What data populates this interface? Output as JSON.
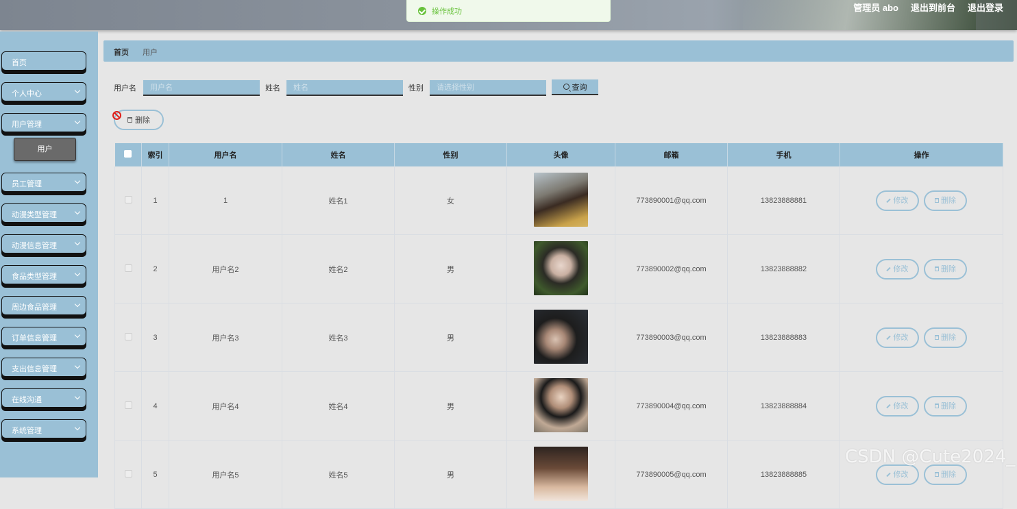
{
  "header": {
    "admin_label": "管理员 abo",
    "exit_front_label": "退出到前台",
    "logout_label": "退出登录"
  },
  "toast": {
    "message": "操作成功",
    "icon": "check-circle-icon",
    "color": "#67c23a"
  },
  "sidebar": {
    "items": [
      {
        "label": "首页",
        "expandable": false
      },
      {
        "label": "个人中心",
        "expandable": true
      },
      {
        "label": "用户管理",
        "expandable": true
      },
      {
        "label": "员工管理",
        "expandable": true
      },
      {
        "label": "动漫类型管理",
        "expandable": true
      },
      {
        "label": "动漫信息管理",
        "expandable": true
      },
      {
        "label": "食品类型管理",
        "expandable": true
      },
      {
        "label": "周边食品管理",
        "expandable": true
      },
      {
        "label": "订单信息管理",
        "expandable": true
      },
      {
        "label": "支出信息管理",
        "expandable": true
      },
      {
        "label": "在线沟通",
        "expandable": true
      },
      {
        "label": "系统管理",
        "expandable": true
      }
    ],
    "active_sub_item": "用户"
  },
  "breadcrumb": {
    "home": "首页",
    "current": "用户"
  },
  "search": {
    "username_label": "用户名",
    "username_placeholder": "用户名",
    "name_label": "姓名",
    "name_placeholder": "姓名",
    "gender_label": "性别",
    "gender_placeholder": "请选择性别",
    "query_label": "查询"
  },
  "toolbar": {
    "delete_label": "删除"
  },
  "table": {
    "headers": [
      "索引",
      "用户名",
      "姓名",
      "性别",
      "头像",
      "邮箱",
      "手机",
      "操作"
    ],
    "edit_label": "修改",
    "delete_label": "删除",
    "rows": [
      {
        "index": "1",
        "username": "1",
        "name": "姓名1",
        "gender": "女",
        "email": "773890001@qq.com",
        "phone": "13823888881"
      },
      {
        "index": "2",
        "username": "用户名2",
        "name": "姓名2",
        "gender": "男",
        "email": "773890002@qq.com",
        "phone": "13823888882"
      },
      {
        "index": "3",
        "username": "用户名3",
        "name": "姓名3",
        "gender": "男",
        "email": "773890003@qq.com",
        "phone": "13823888883"
      },
      {
        "index": "4",
        "username": "用户名4",
        "name": "姓名4",
        "gender": "男",
        "email": "773890004@qq.com",
        "phone": "13823888884"
      },
      {
        "index": "5",
        "username": "用户名5",
        "name": "姓名5",
        "gender": "男",
        "email": "773890005@qq.com",
        "phone": "13823888885"
      }
    ]
  },
  "watermark": "CSDN @Cute2024_",
  "colors": {
    "accent": "#9ac0d6",
    "background": "#e6e6e6",
    "success": "#67c23a"
  }
}
